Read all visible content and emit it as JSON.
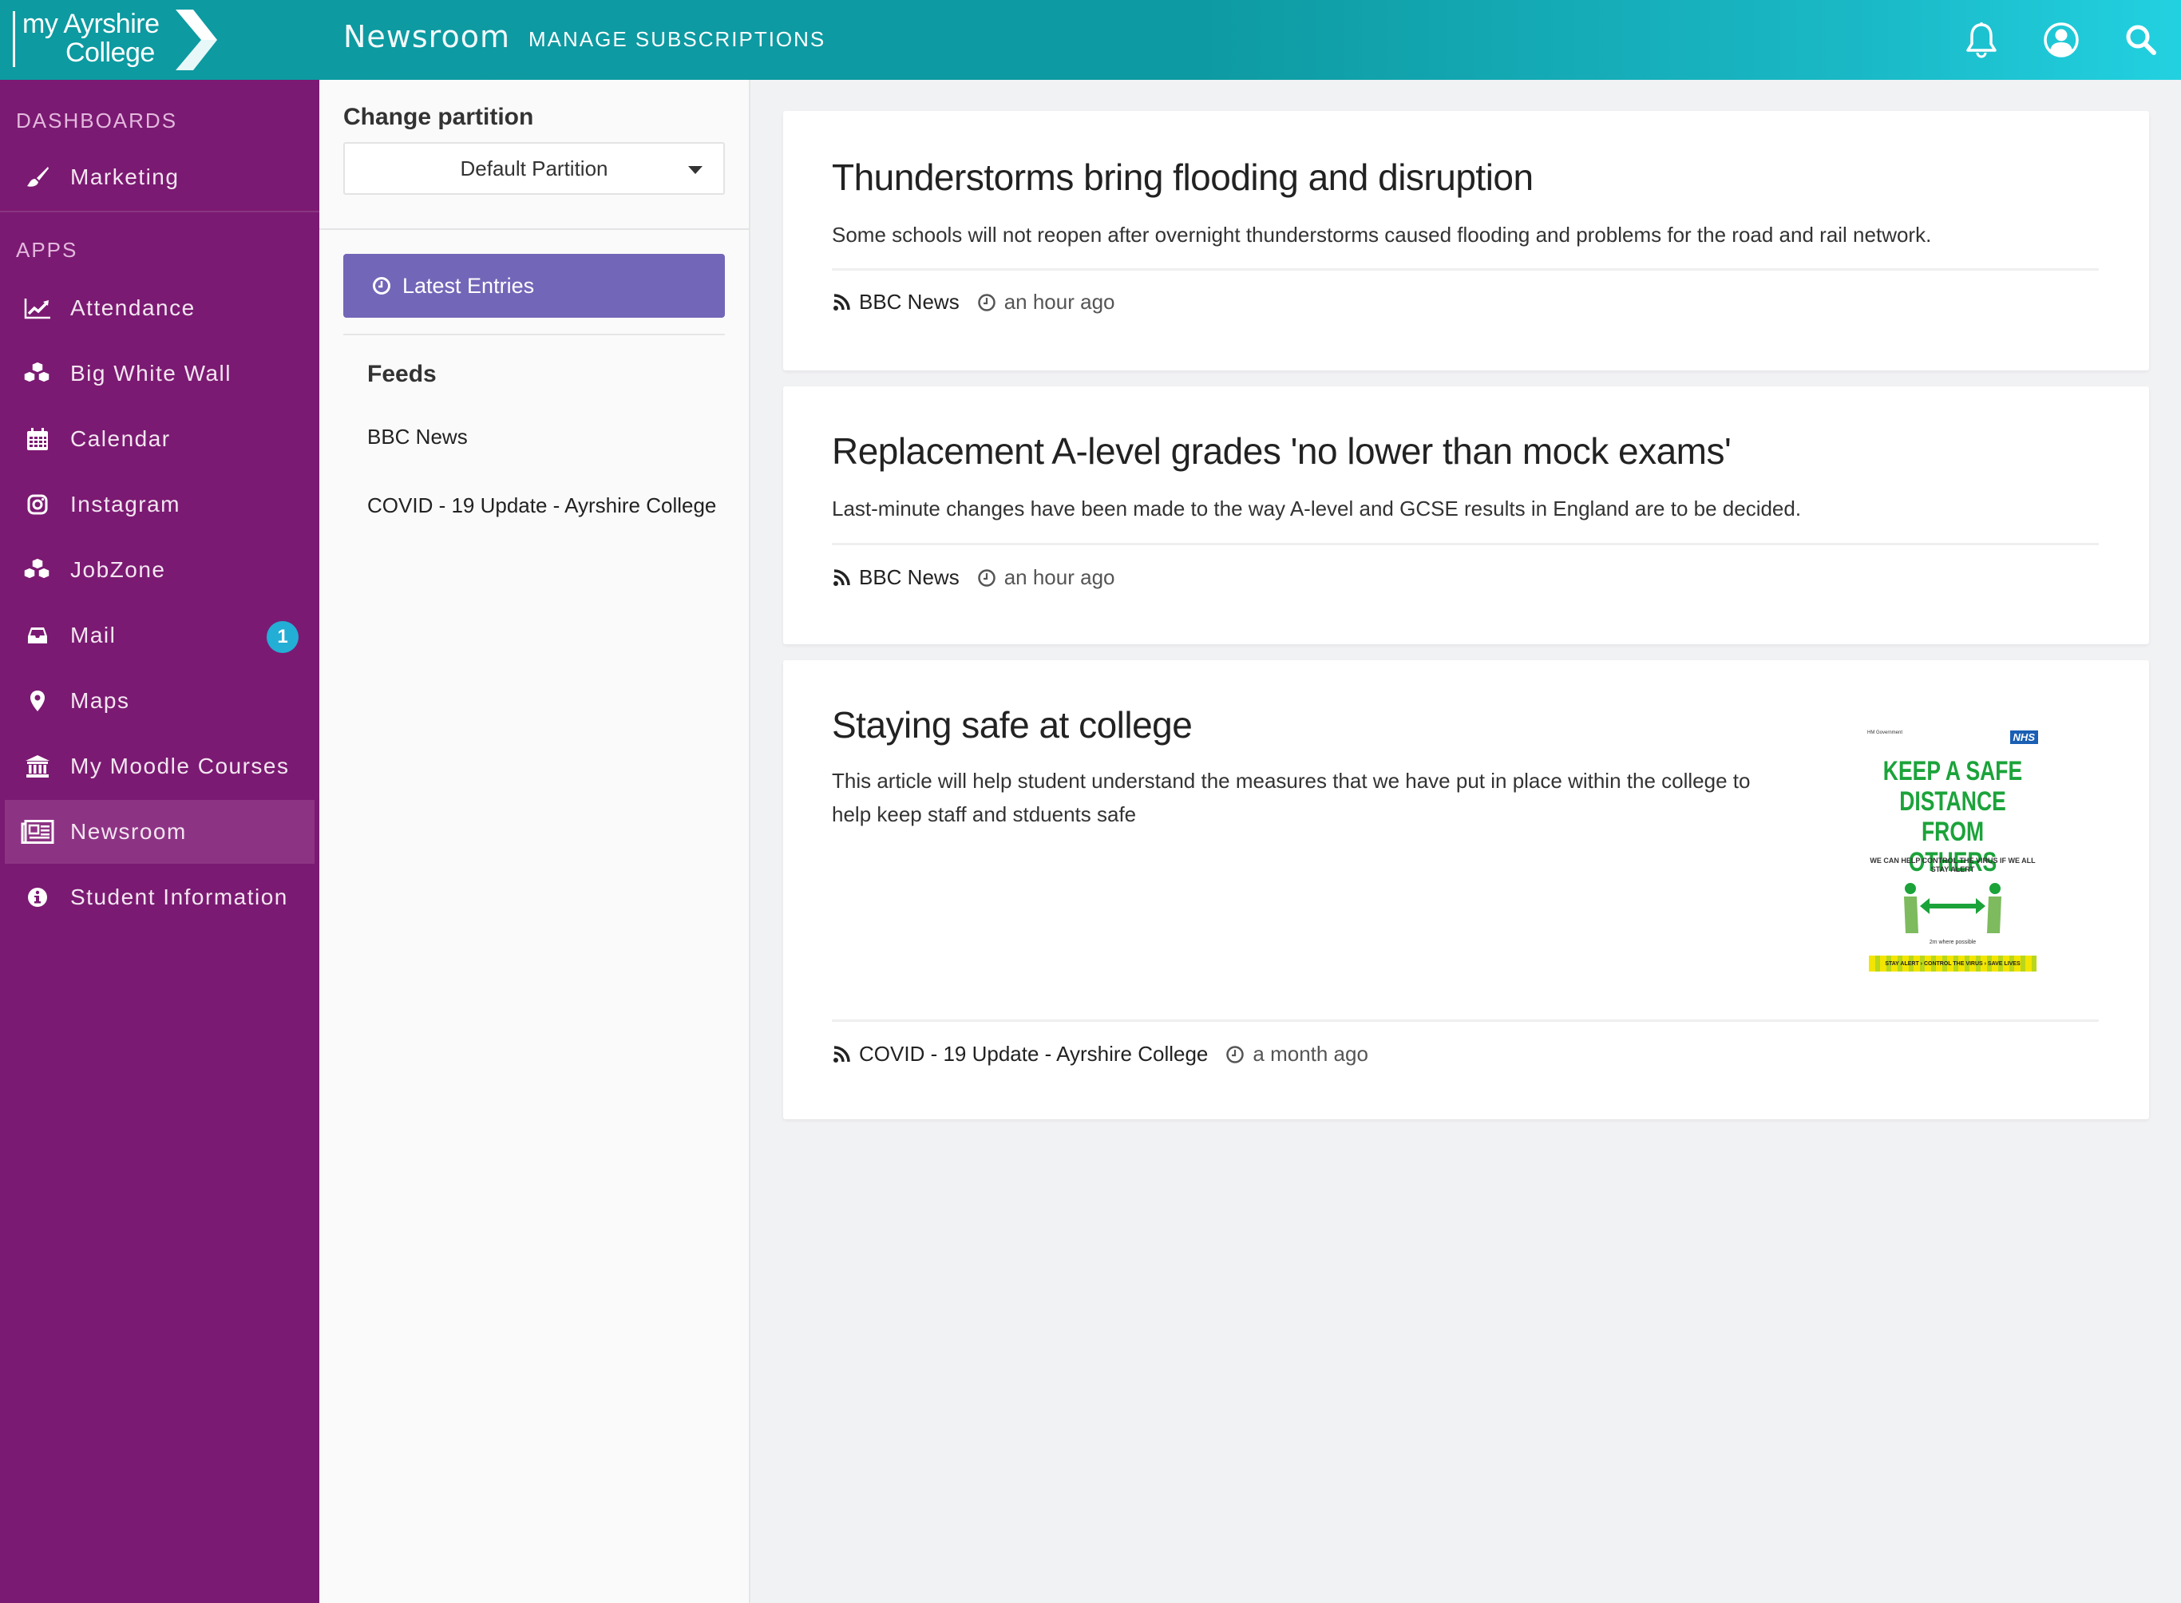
{
  "header": {
    "logo_line1": "my Ayrshire",
    "logo_line2": "College",
    "app_title": "Newsroom",
    "manage_subscriptions": "MANAGE SUBSCRIPTIONS",
    "icons": [
      "bell-icon",
      "user-circle-icon",
      "search-icon"
    ],
    "gradient_start": "#0d9aa1",
    "gradient_end": "#22d1e0"
  },
  "sidebar": {
    "background": "#7b1a72",
    "sections": {
      "dashboards": "DASHBOARDS",
      "apps": "APPS"
    },
    "dashboards": [
      {
        "label": "Marketing",
        "icon": "paintbrush-icon"
      }
    ],
    "apps": [
      {
        "label": "Attendance",
        "icon": "line-chart-icon"
      },
      {
        "label": "Big White Wall",
        "icon": "cubes-icon"
      },
      {
        "label": "Calendar",
        "icon": "calendar-icon"
      },
      {
        "label": "Instagram",
        "icon": "instagram-icon"
      },
      {
        "label": "JobZone",
        "icon": "cubes-icon"
      },
      {
        "label": "Mail",
        "icon": "inbox-icon",
        "badge": "1"
      },
      {
        "label": "Maps",
        "icon": "map-marker-icon"
      },
      {
        "label": "My Moodle Courses",
        "icon": "institution-icon"
      },
      {
        "label": "Newsroom",
        "icon": "newspaper-icon",
        "active": true
      },
      {
        "label": "Student Information",
        "icon": "info-circle-icon"
      }
    ]
  },
  "partition_panel": {
    "heading": "Change partition",
    "selected_partition": "Default Partition",
    "latest_entries_label": "Latest Entries",
    "latest_entries_color": "#7266b8",
    "feeds_title": "Feeds",
    "feeds": [
      "BBC News",
      "COVID - 19 Update - Ayrshire College"
    ]
  },
  "articles": [
    {
      "title": "Thunderstorms bring flooding and disruption",
      "description": "Some schools will not reopen after overnight thunderstorms caused flooding and problems for the road and rail network.",
      "source": "BBC News",
      "time": "an hour ago"
    },
    {
      "title": "Replacement A-level grades 'no lower than mock exams'",
      "description": "Last-minute changes have been made to the way A-level and GCSE results in England are to be decided.",
      "source": "BBC News",
      "time": "an hour ago"
    },
    {
      "title": "Staying safe at college",
      "description": "This article will help student understand the measures that we have put in place within the college to help keep staff and stduents safe",
      "source": "COVID - 19 Update - Ayrshire College",
      "time": "a month ago",
      "image": {
        "govt": "HM Government",
        "nhs": "NHS",
        "headline": "KEEP A SAFE DISTANCE FROM OTHERS",
        "subline": "WE CAN HELP CONTROL THE VIRUS IF WE ALL STAY ALERT",
        "distance_note": "2m where possible",
        "strip": "STAY ALERT › CONTROL THE VIRUS › SAVE LIVES"
      }
    }
  ]
}
